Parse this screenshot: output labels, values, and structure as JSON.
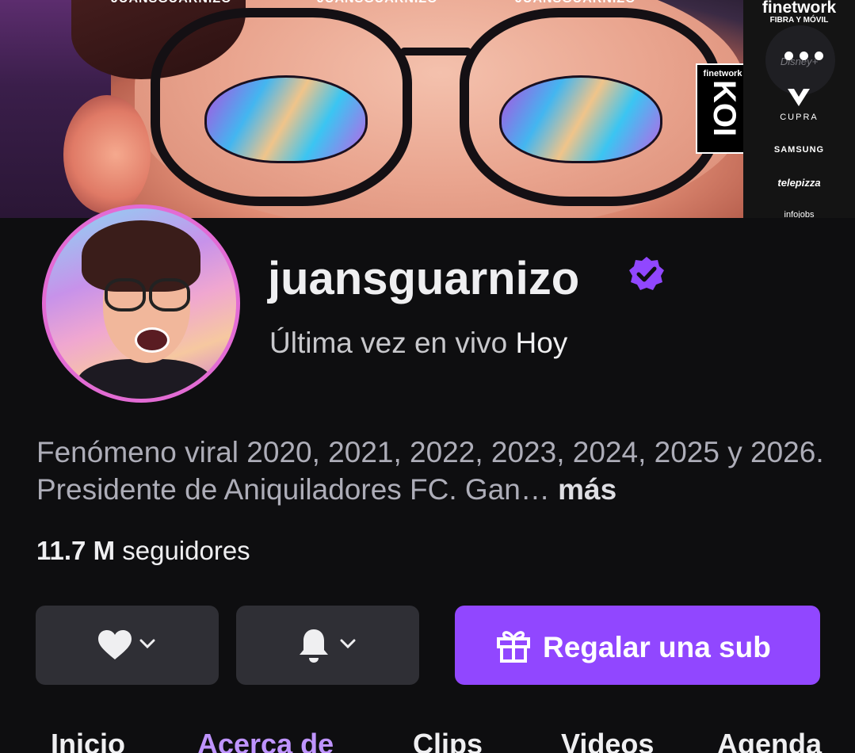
{
  "banner": {
    "socials": [
      "JUANSGUARNIZO",
      "JUANSGUARNIZO",
      "JUANSGUARNIZO"
    ],
    "koi_brand": "finetwork",
    "koi_text": "KOI",
    "sponsors": {
      "finetwork": "finetwork",
      "fibra": "FIBRA Y MÓVIL",
      "disney": "Disney+",
      "cupra": "CUPRA",
      "samsung": "SAMSUNG",
      "telepizza": "telepizza",
      "last": "infojobs"
    }
  },
  "profile": {
    "username": "juansguarnizo",
    "verified": true,
    "last_live_prefix": "Última vez en vivo ",
    "last_live_value": "Hoy",
    "bio": "Fenómeno viral 2020, 2021, 2022, 2023, 2024, 2025 y 2026. Presidente de Aniquiladores FC. Gan…",
    "bio_more": "más",
    "followers_count": "11.7 M",
    "followers_label": " seguidores"
  },
  "actions": {
    "gift_label": "Regalar una sub"
  },
  "tabs": [
    {
      "label": "Inicio"
    },
    {
      "label": "Acerca de"
    },
    {
      "label": "Clips"
    },
    {
      "label": "Videos"
    },
    {
      "label": "Agenda"
    }
  ],
  "colors": {
    "background": "#0e0e10",
    "accent": "#9147ff",
    "active_tab": "#bf94ff",
    "button_bg": "#2f2f35"
  }
}
